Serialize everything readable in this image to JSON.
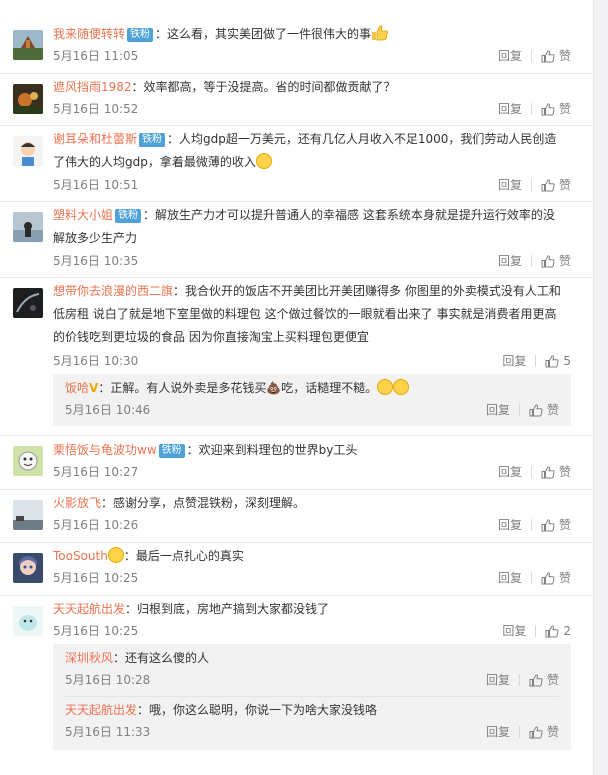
{
  "actions": {
    "reply": "回复",
    "like": "赞"
  },
  "badge_label": "铁粉",
  "comments": [
    {
      "user": "我来随便转转",
      "badge": true,
      "text": "：这么看，其实美团做了一件很伟大的事",
      "time": "5月16日 11:05"
    },
    {
      "user": "遮风挡雨1982",
      "badge": false,
      "text": "：效率都高，等于没提高。省的时间都做贡献了？",
      "time": "5月16日 10:52"
    },
    {
      "user": "谢耳朵和杜蕾斯",
      "badge": true,
      "text": "：人均gdp超一万美元，还有几亿人月收入不足1000，我们劳动人民创造了伟大的人均gdp，拿着最微薄的收入",
      "time": "5月16日 10:51"
    },
    {
      "user": "塑料大小姐",
      "badge": true,
      "text": "：解放生产力才可以提升普通人的幸福感 这套系统本身就是提升运行效率的没解放多少生产力",
      "time": "5月16日 10:35"
    },
    {
      "user": "想带你去浪漫的西二旗",
      "badge": false,
      "text": "：我合伙开的饭店不开美团比开美团赚得多 你图里的外卖模式没有人工和低房租 说白了就是地下室里做的料理包 这个做过餐饮的一眼就看出来了 事实就是消费者用更高的价钱吃到更垃圾的食品  因为你直接淘宝上买料理包更便宜",
      "time": "5月16日 10:30",
      "likes": "5",
      "reply": {
        "user": "饭哈",
        "text": "：正解。有人说外卖是多花钱买💩吃，话糙理不糙。",
        "time": "5月16日 10:46"
      }
    },
    {
      "user": "栗悟饭与龟波功ww",
      "badge": true,
      "text": "：欢迎来到料理包的世界by工头",
      "time": "5月16日 10:27"
    },
    {
      "user": "火影放飞",
      "badge": false,
      "text": "：感谢分享，点赞混铁粉，深刻理解。",
      "time": "5月16日 10:26"
    },
    {
      "user": "TooSouth",
      "badge": false,
      "text": "：最后一点扎心的真实",
      "time": "5月16日 10:25"
    },
    {
      "user": "天天起航出发",
      "badge": false,
      "text": "：归根到底，房地产搞到大家都没钱了",
      "time": "5月16日 10:25",
      "likes": "2",
      "replies": [
        {
          "user": "深圳秋风",
          "text": "：还有这么傻的人",
          "time": "5月16日 10:28"
        },
        {
          "user": "天天起航出发",
          "text": "：哦，你这么聪明，你说一下为啥大家没钱咯",
          "time": "5月16日 11:33"
        }
      ]
    }
  ]
}
